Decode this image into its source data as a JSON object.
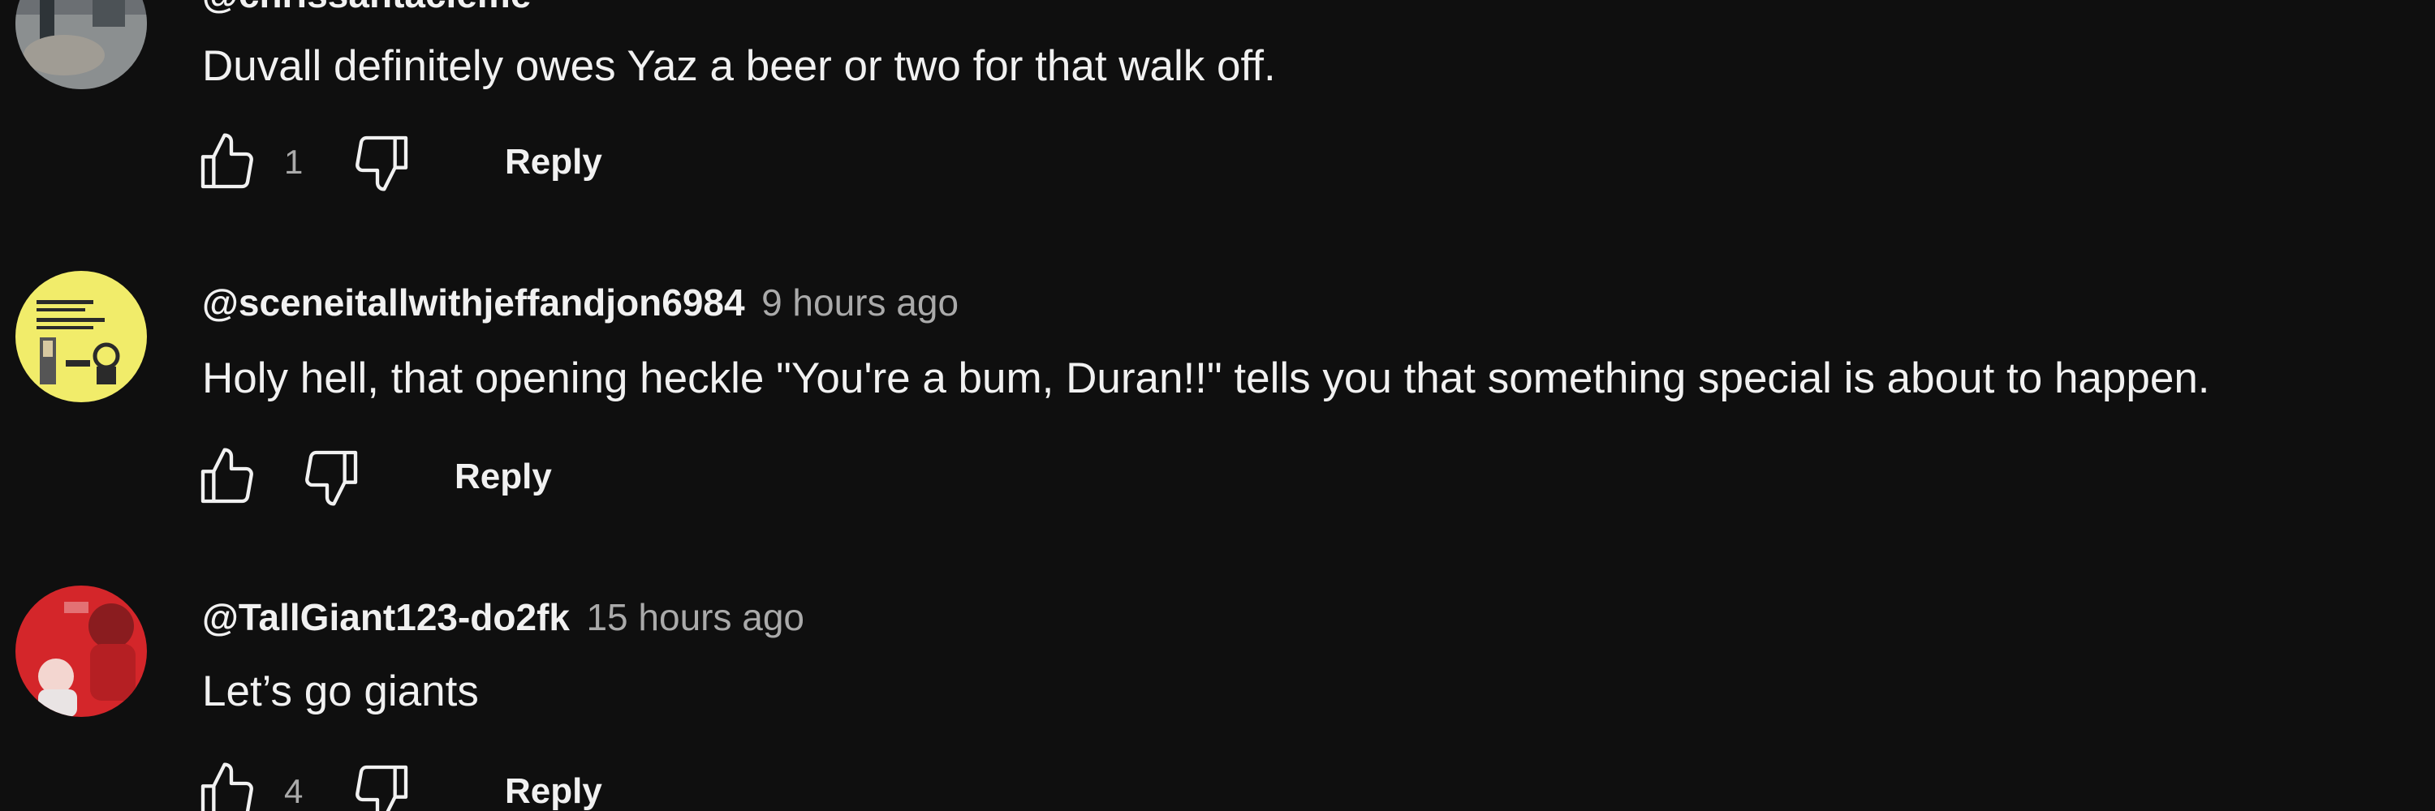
{
  "comments": [
    {
      "author": "@chrissantacleme",
      "time": "",
      "text": "Duvall definitely owes Yaz a beer or two for that walk off.",
      "likes": "1",
      "reply_label": "Reply",
      "avatar_icon": "photo-avatar-icon"
    },
    {
      "author": "@sceneitallwithjeffandjon6984",
      "time": "9 hours ago",
      "text": "Holy hell, that opening heckle \"You're a bum, Duran!!\" tells you that something special is about to happen.",
      "likes": "",
      "reply_label": "Reply",
      "avatar_icon": "yellow-logo-avatar-icon"
    },
    {
      "author": "@TallGiant123-do2fk",
      "time": "15 hours ago",
      "text": "Let’s go giants",
      "likes": "4",
      "reply_label": "Reply",
      "avatar_icon": "red-player-avatar-icon"
    }
  ],
  "colors": {
    "background": "#0f0f0f",
    "text_primary": "#f1f1f1",
    "text_secondary": "#aaaaaa"
  }
}
